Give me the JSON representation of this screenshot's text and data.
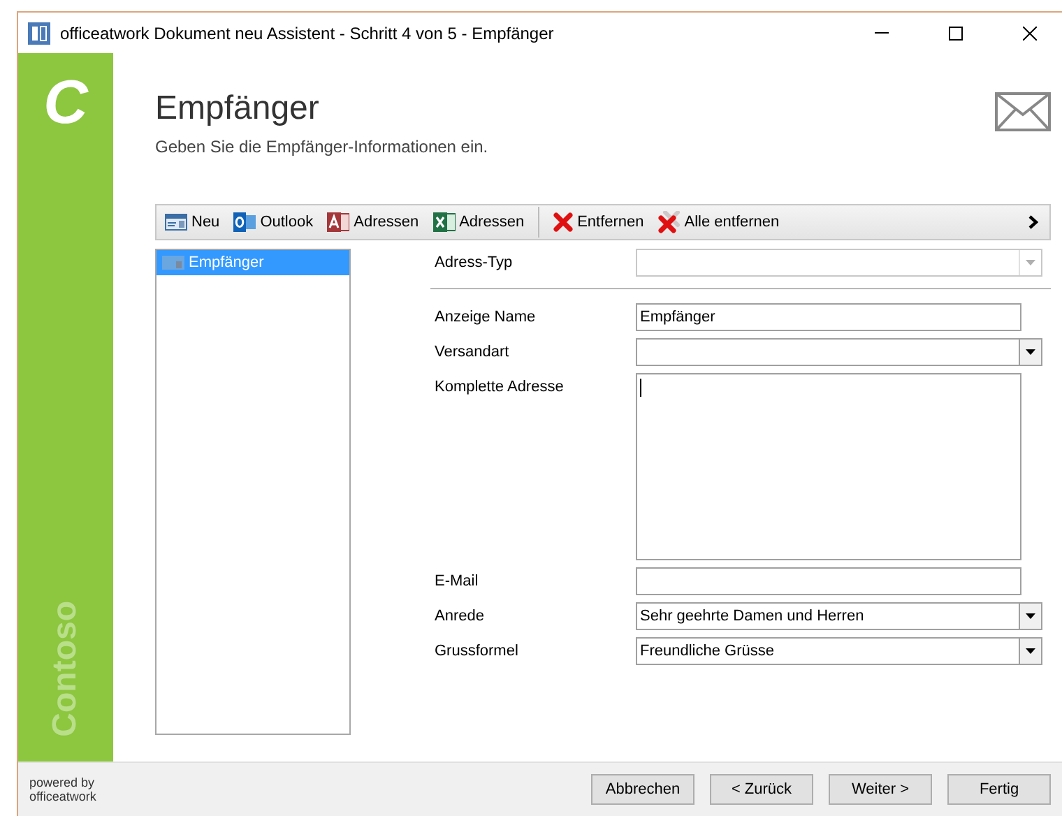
{
  "window": {
    "title": "officeatwork Dokument neu Assistent - Schritt 4 von 5 - Empfänger"
  },
  "sidebar": {
    "logo": "C",
    "brand": "Contoso"
  },
  "header": {
    "title": "Empfänger",
    "subtitle": "Geben Sie die Empfänger-Informationen ein."
  },
  "toolbar": [
    [
      {
        "label": "Neu",
        "kind": "card"
      },
      {
        "label": "Outlook",
        "kind": "outlook"
      },
      {
        "label": "Adressen",
        "kind": "access"
      },
      {
        "label": "Adressen",
        "kind": "excel"
      }
    ],
    [
      {
        "label": "Entfernen",
        "kind": "remove"
      },
      {
        "label": "Alle entfernen",
        "kind": "removeall"
      }
    ]
  ],
  "recipients": [
    {
      "label": "Empfänger",
      "selected": true
    }
  ],
  "type_field": {
    "label": "Adress-Typ",
    "disabled": true
  },
  "fields": [
    {
      "label": "Anzeige Name",
      "kind": "text",
      "value": "Empfänger"
    },
    {
      "label": "Versandart",
      "kind": "combo"
    },
    {
      "label": "Komplette Adresse",
      "kind": "textarea"
    },
    {
      "label": "E-Mail",
      "kind": "text"
    },
    {
      "label": "Anrede",
      "kind": "combo",
      "value": "Sehr geehrte Damen und Herren"
    },
    {
      "label": "Grussformel",
      "kind": "combo",
      "value": "Freundliche Grüsse"
    }
  ],
  "footer": {
    "powered": "powered by",
    "brand": "officeatwork"
  },
  "buttons": [
    "Abbrechen",
    "< Zurück",
    "Weiter >",
    "Fertig"
  ]
}
